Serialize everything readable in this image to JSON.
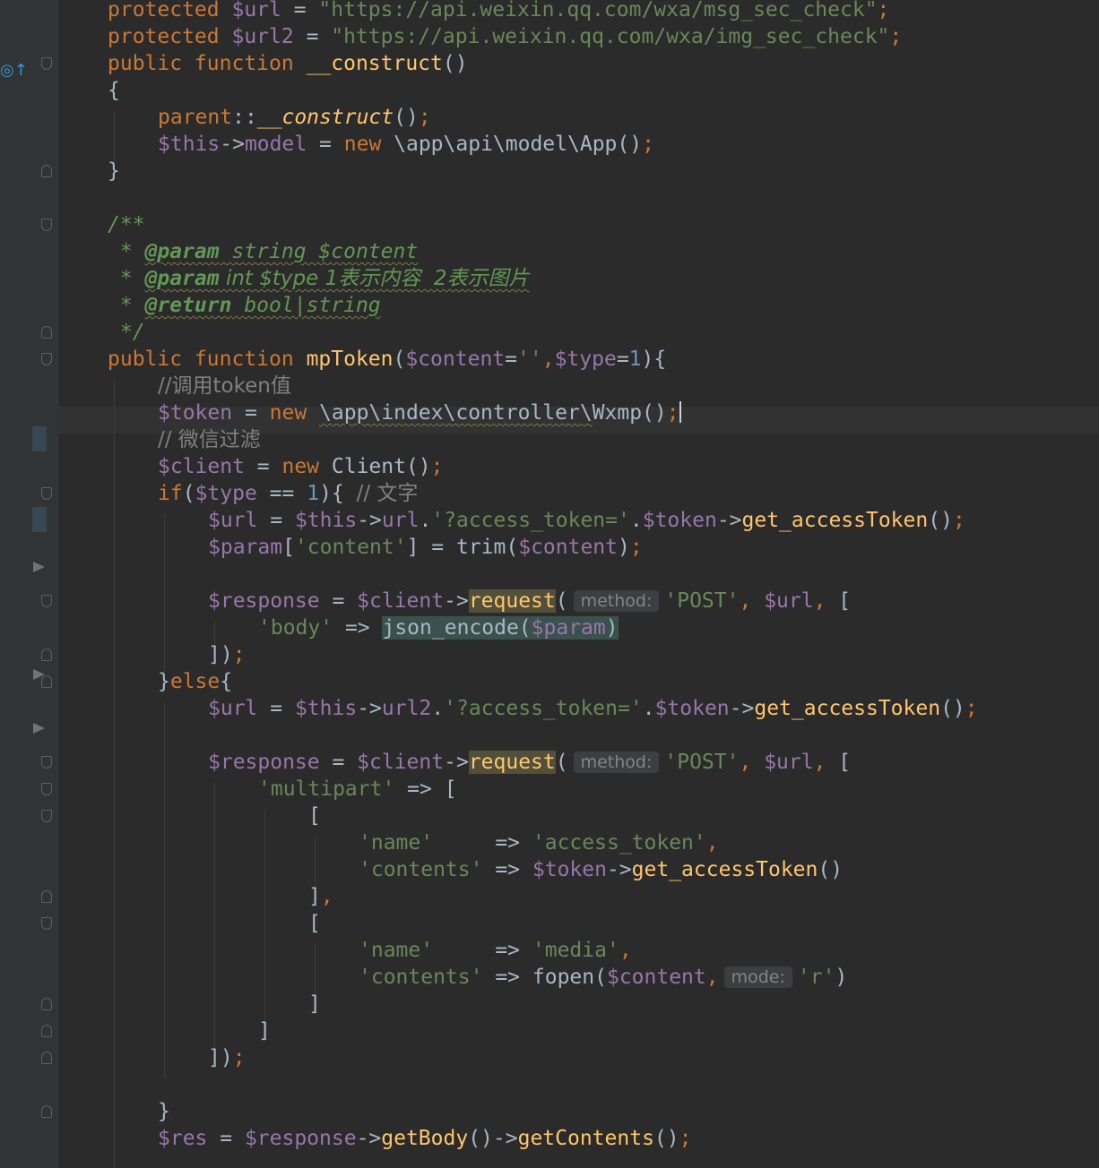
{
  "editor": {
    "language": "php",
    "colors": {
      "background": "#2b2b2b",
      "keyword": "#cc7832",
      "variable": "#9876aa",
      "string": "#6a8759",
      "number": "#6897bb",
      "function": "#ffc66d",
      "comment": "#808080",
      "doc_comment": "#629755"
    },
    "gutter": {
      "implements_marker_icon": "override-up-arrow-icon",
      "fold_marker_icon": "fold-marker-icon",
      "breakpoint_arrow_icon": "run-arrow-icon"
    },
    "lines": [
      {
        "parts": [
          {
            "c": "k",
            "t": "protected "
          },
          {
            "c": "v",
            "t": "$url"
          },
          {
            "c": "p",
            "t": " = "
          },
          {
            "c": "s",
            "t": "\"https://api.weixin.qq.com/wxa/msg_sec_check\""
          },
          {
            "c": "k",
            "t": ";"
          }
        ]
      },
      {
        "parts": [
          {
            "c": "k",
            "t": "protected "
          },
          {
            "c": "v",
            "t": "$url2"
          },
          {
            "c": "p",
            "t": " = "
          },
          {
            "c": "s",
            "t": "\"https://api.weixin.qq.com/wxa/img_sec_check\""
          },
          {
            "c": "k",
            "t": ";"
          }
        ]
      },
      {
        "parts": [
          {
            "c": "k",
            "t": "public function "
          },
          {
            "c": "f",
            "t": "__construct"
          },
          {
            "c": "p",
            "t": "()"
          }
        ]
      },
      {
        "parts": [
          {
            "c": "p",
            "t": "{"
          }
        ]
      },
      {
        "parts": [
          {
            "c": "k",
            "t": "parent"
          },
          {
            "c": "p",
            "t": "::"
          },
          {
            "c": "fi",
            "t": "__construct"
          },
          {
            "c": "p",
            "t": "()"
          },
          {
            "c": "k",
            "t": ";"
          }
        ]
      },
      {
        "parts": [
          {
            "c": "v",
            "t": "$this"
          },
          {
            "c": "p",
            "t": "->"
          },
          {
            "c": "v",
            "t": "model"
          },
          {
            "c": "p",
            "t": " = "
          },
          {
            "c": "k",
            "t": "new "
          },
          {
            "c": "p",
            "t": "\\app\\api\\model\\App()"
          },
          {
            "c": "k",
            "t": ";"
          }
        ]
      },
      {
        "parts": [
          {
            "c": "p",
            "t": "}"
          }
        ]
      },
      {
        "parts": []
      },
      {
        "parts": [
          {
            "c": "doc",
            "t": "/**"
          }
        ]
      },
      {
        "parts": [
          {
            "c": "doc",
            "t": " * "
          },
          {
            "c": "doct",
            "t": "@param"
          },
          {
            "c": "doc",
            "t": " string $content"
          }
        ]
      },
      {
        "parts": [
          {
            "c": "doc",
            "t": " * "
          },
          {
            "c": "doct",
            "t": "@param"
          },
          {
            "c": "doc",
            "t": " int $type 1表示内容  2表示图片"
          }
        ]
      },
      {
        "parts": [
          {
            "c": "doc",
            "t": " * "
          },
          {
            "c": "doct",
            "t": "@return"
          },
          {
            "c": "doc",
            "t": " bool|string"
          }
        ]
      },
      {
        "parts": [
          {
            "c": "doc",
            "t": " */"
          }
        ]
      },
      {
        "parts": [
          {
            "c": "k",
            "t": "public function "
          },
          {
            "c": "f",
            "t": "mpToken"
          },
          {
            "c": "p",
            "t": "("
          },
          {
            "c": "v",
            "t": "$content"
          },
          {
            "c": "p",
            "t": "="
          },
          {
            "c": "s",
            "t": "''"
          },
          {
            "c": "k",
            "t": ","
          },
          {
            "c": "v",
            "t": "$type"
          },
          {
            "c": "p",
            "t": "="
          },
          {
            "c": "n",
            "t": "1"
          },
          {
            "c": "p",
            "t": "){"
          }
        ]
      },
      {
        "parts": [
          {
            "c": "cm",
            "t": "//调用token值"
          }
        ]
      },
      {
        "parts": [
          {
            "c": "v",
            "t": "$token"
          },
          {
            "c": "p",
            "t": " = "
          },
          {
            "c": "k",
            "t": "new "
          },
          {
            "c": "pw",
            "t": "\\app\\index\\controller\\"
          },
          {
            "c": "p",
            "t": "Wxmp()"
          },
          {
            "c": "k",
            "t": ";"
          }
        ]
      },
      {
        "parts": [
          {
            "c": "cm",
            "t": "// 微信过滤"
          }
        ]
      },
      {
        "parts": [
          {
            "c": "v",
            "t": "$client"
          },
          {
            "c": "p",
            "t": " = "
          },
          {
            "c": "k",
            "t": "new "
          },
          {
            "c": "p",
            "t": "Client()"
          },
          {
            "c": "k",
            "t": ";"
          }
        ]
      },
      {
        "parts": [
          {
            "c": "k",
            "t": "if"
          },
          {
            "c": "p",
            "t": "("
          },
          {
            "c": "v",
            "t": "$type"
          },
          {
            "c": "p",
            "t": " == "
          },
          {
            "c": "n",
            "t": "1"
          },
          {
            "c": "p",
            "t": "){ "
          },
          {
            "c": "cm",
            "t": "// 文字"
          }
        ]
      },
      {
        "parts": [
          {
            "c": "v",
            "t": "$url"
          },
          {
            "c": "p",
            "t": " = "
          },
          {
            "c": "v",
            "t": "$this"
          },
          {
            "c": "p",
            "t": "->"
          },
          {
            "c": "v",
            "t": "url"
          },
          {
            "c": "p",
            "t": "."
          },
          {
            "c": "s",
            "t": "'?access_token='"
          },
          {
            "c": "p",
            "t": "."
          },
          {
            "c": "v",
            "t": "$token"
          },
          {
            "c": "p",
            "t": "->"
          },
          {
            "c": "f",
            "t": "get_accessToken"
          },
          {
            "c": "p",
            "t": "()"
          },
          {
            "c": "k",
            "t": ";"
          }
        ]
      },
      {
        "parts": [
          {
            "c": "v",
            "t": "$param"
          },
          {
            "c": "p",
            "t": "["
          },
          {
            "c": "s",
            "t": "'content'"
          },
          {
            "c": "p",
            "t": "] = "
          },
          {
            "c": "p",
            "t": "trim("
          },
          {
            "c": "v",
            "t": "$content"
          },
          {
            "c": "p",
            "t": ")"
          },
          {
            "c": "k",
            "t": ";"
          }
        ]
      },
      {
        "parts": []
      },
      {
        "parts": [
          {
            "c": "v",
            "t": "$response"
          },
          {
            "c": "p",
            "t": " = "
          },
          {
            "c": "v",
            "t": "$client"
          },
          {
            "c": "p",
            "t": "->"
          },
          {
            "c": "fh",
            "t": "request"
          },
          {
            "c": "p",
            "t": "("
          },
          {
            "c": "hint",
            "t": "method:"
          },
          {
            "c": "s",
            "t": "'POST'"
          },
          {
            "c": "k",
            "t": ", "
          },
          {
            "c": "v",
            "t": "$url"
          },
          {
            "c": "k",
            "t": ", "
          },
          {
            "c": "p",
            "t": "["
          }
        ]
      },
      {
        "parts": [
          {
            "c": "s",
            "t": "'body'"
          },
          {
            "c": "p",
            "t": " => "
          },
          {
            "c": "h2",
            "t": "json_encode("
          },
          {
            "c": "h2v",
            "t": "$param"
          },
          {
            "c": "h2",
            "t": ")"
          }
        ]
      },
      {
        "parts": [
          {
            "c": "p",
            "t": "])"
          },
          {
            "c": "k",
            "t": ";"
          }
        ]
      },
      {
        "parts": [
          {
            "c": "p",
            "t": "}"
          },
          {
            "c": "k",
            "t": "else"
          },
          {
            "c": "p",
            "t": "{"
          }
        ]
      },
      {
        "parts": [
          {
            "c": "v",
            "t": "$url"
          },
          {
            "c": "p",
            "t": " = "
          },
          {
            "c": "v",
            "t": "$this"
          },
          {
            "c": "p",
            "t": "->"
          },
          {
            "c": "v",
            "t": "url2"
          },
          {
            "c": "p",
            "t": "."
          },
          {
            "c": "s",
            "t": "'?access_token='"
          },
          {
            "c": "p",
            "t": "."
          },
          {
            "c": "v",
            "t": "$token"
          },
          {
            "c": "p",
            "t": "->"
          },
          {
            "c": "f",
            "t": "get_accessToken"
          },
          {
            "c": "p",
            "t": "()"
          },
          {
            "c": "k",
            "t": ";"
          }
        ]
      },
      {
        "parts": []
      },
      {
        "parts": [
          {
            "c": "v",
            "t": "$response"
          },
          {
            "c": "p",
            "t": " = "
          },
          {
            "c": "v",
            "t": "$client"
          },
          {
            "c": "p",
            "t": "->"
          },
          {
            "c": "fh",
            "t": "request"
          },
          {
            "c": "p",
            "t": "("
          },
          {
            "c": "hint",
            "t": "method:"
          },
          {
            "c": "s",
            "t": "'POST'"
          },
          {
            "c": "k",
            "t": ", "
          },
          {
            "c": "v",
            "t": "$url"
          },
          {
            "c": "k",
            "t": ", "
          },
          {
            "c": "p",
            "t": "["
          }
        ]
      },
      {
        "parts": [
          {
            "c": "s",
            "t": "'multipart'"
          },
          {
            "c": "p",
            "t": " => ["
          }
        ]
      },
      {
        "parts": [
          {
            "c": "p",
            "t": "["
          }
        ]
      },
      {
        "parts": [
          {
            "c": "s",
            "t": "'name'"
          },
          {
            "c": "p",
            "t": "     => "
          },
          {
            "c": "s",
            "t": "'access_token'"
          },
          {
            "c": "k",
            "t": ","
          }
        ]
      },
      {
        "parts": [
          {
            "c": "s",
            "t": "'contents'"
          },
          {
            "c": "p",
            "t": " => "
          },
          {
            "c": "v",
            "t": "$token"
          },
          {
            "c": "p",
            "t": "->"
          },
          {
            "c": "f",
            "t": "get_accessToken"
          },
          {
            "c": "p",
            "t": "()"
          }
        ]
      },
      {
        "parts": [
          {
            "c": "p",
            "t": "]"
          },
          {
            "c": "k",
            "t": ","
          }
        ]
      },
      {
        "parts": [
          {
            "c": "p",
            "t": "["
          }
        ]
      },
      {
        "parts": [
          {
            "c": "s",
            "t": "'name'"
          },
          {
            "c": "p",
            "t": "     => "
          },
          {
            "c": "s",
            "t": "'media'"
          },
          {
            "c": "k",
            "t": ","
          }
        ]
      },
      {
        "parts": [
          {
            "c": "s",
            "t": "'contents'"
          },
          {
            "c": "p",
            "t": " => "
          },
          {
            "c": "p",
            "t": "fopen("
          },
          {
            "c": "v",
            "t": "$content"
          },
          {
            "c": "k",
            "t": ","
          },
          {
            "c": "hint",
            "t": "mode:"
          },
          {
            "c": "s",
            "t": "'r'"
          },
          {
            "c": "p",
            "t": ")"
          }
        ]
      },
      {
        "parts": [
          {
            "c": "p",
            "t": "]"
          }
        ]
      },
      {
        "parts": [
          {
            "c": "p",
            "t": "]"
          }
        ]
      },
      {
        "parts": [
          {
            "c": "p",
            "t": "])"
          },
          {
            "c": "k",
            "t": ";"
          }
        ]
      },
      {
        "parts": []
      },
      {
        "parts": [
          {
            "c": "p",
            "t": "}"
          }
        ]
      },
      {
        "parts": [
          {
            "c": "v",
            "t": "$res"
          },
          {
            "c": "p",
            "t": " = "
          },
          {
            "c": "v",
            "t": "$response"
          },
          {
            "c": "p",
            "t": "->"
          },
          {
            "c": "f",
            "t": "getBody"
          },
          {
            "c": "p",
            "t": "()->"
          },
          {
            "c": "f",
            "t": "getContents"
          },
          {
            "c": "p",
            "t": "()"
          },
          {
            "c": "k",
            "t": ";"
          }
        ]
      }
    ]
  }
}
